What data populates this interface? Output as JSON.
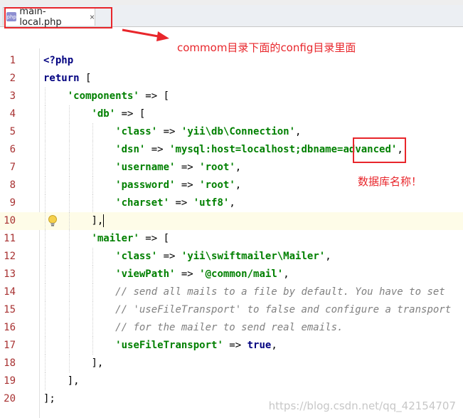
{
  "editor": {
    "tab": {
      "file_name": "main-local.php",
      "icon_label": "php",
      "close_glyph": "×"
    }
  },
  "annotations": {
    "config_note": "commom目录下面的config目录里面",
    "db_note": "数据库名称！"
  },
  "code": {
    "lines": [
      {
        "n": "1",
        "indent": 0,
        "parts": [
          {
            "t": "<?php",
            "c": "k"
          }
        ]
      },
      {
        "n": "2",
        "indent": 0,
        "parts": [
          {
            "t": "return",
            "c": "k"
          },
          {
            "t": " [",
            "c": ""
          }
        ]
      },
      {
        "n": "3",
        "indent": 1,
        "parts": [
          {
            "t": "'components'",
            "c": "s"
          },
          {
            "t": " => [",
            "c": ""
          }
        ]
      },
      {
        "n": "4",
        "indent": 2,
        "parts": [
          {
            "t": "'db'",
            "c": "s"
          },
          {
            "t": " => [",
            "c": ""
          }
        ]
      },
      {
        "n": "5",
        "indent": 3,
        "parts": [
          {
            "t": "'class'",
            "c": "s"
          },
          {
            "t": " => ",
            "c": ""
          },
          {
            "t": "'yii\\db\\Connection'",
            "c": "s"
          },
          {
            "t": ",",
            "c": ""
          }
        ]
      },
      {
        "n": "6",
        "indent": 3,
        "parts": [
          {
            "t": "'dsn'",
            "c": "s"
          },
          {
            "t": " => ",
            "c": ""
          },
          {
            "t": "'mysql:host=localhost;dbname=advanced'",
            "c": "s"
          },
          {
            "t": ",",
            "c": ""
          }
        ]
      },
      {
        "n": "7",
        "indent": 3,
        "parts": [
          {
            "t": "'username'",
            "c": "s"
          },
          {
            "t": " => ",
            "c": ""
          },
          {
            "t": "'root'",
            "c": "s"
          },
          {
            "t": ",",
            "c": ""
          }
        ]
      },
      {
        "n": "8",
        "indent": 3,
        "parts": [
          {
            "t": "'password'",
            "c": "s"
          },
          {
            "t": " => ",
            "c": ""
          },
          {
            "t": "'root'",
            "c": "s"
          },
          {
            "t": ",",
            "c": ""
          }
        ]
      },
      {
        "n": "9",
        "indent": 3,
        "parts": [
          {
            "t": "'charset'",
            "c": "s"
          },
          {
            "t": " => ",
            "c": ""
          },
          {
            "t": "'utf8'",
            "c": "s"
          },
          {
            "t": ",",
            "c": ""
          }
        ]
      },
      {
        "n": "10",
        "indent": 2,
        "parts": [
          {
            "t": "],",
            "c": ""
          }
        ],
        "current": true,
        "bulb": true,
        "caret": true
      },
      {
        "n": "11",
        "indent": 2,
        "parts": [
          {
            "t": "'mailer'",
            "c": "s"
          },
          {
            "t": " => [",
            "c": ""
          }
        ]
      },
      {
        "n": "12",
        "indent": 3,
        "parts": [
          {
            "t": "'class'",
            "c": "s"
          },
          {
            "t": " => ",
            "c": ""
          },
          {
            "t": "'yii\\swiftmailer\\Mailer'",
            "c": "s"
          },
          {
            "t": ",",
            "c": ""
          }
        ]
      },
      {
        "n": "13",
        "indent": 3,
        "parts": [
          {
            "t": "'viewPath'",
            "c": "s"
          },
          {
            "t": " => ",
            "c": ""
          },
          {
            "t": "'@common/mail'",
            "c": "s"
          },
          {
            "t": ",",
            "c": ""
          }
        ]
      },
      {
        "n": "14",
        "indent": 3,
        "parts": [
          {
            "t": "// send all mails to a file by default. You have to set",
            "c": "c"
          }
        ]
      },
      {
        "n": "15",
        "indent": 3,
        "parts": [
          {
            "t": "// 'useFileTransport' to false and configure a transport",
            "c": "c"
          }
        ]
      },
      {
        "n": "16",
        "indent": 3,
        "parts": [
          {
            "t": "// for the mailer to send real emails.",
            "c": "c"
          }
        ]
      },
      {
        "n": "17",
        "indent": 3,
        "parts": [
          {
            "t": "'useFileTransport'",
            "c": "s"
          },
          {
            "t": " => ",
            "c": ""
          },
          {
            "t": "true",
            "c": "k"
          },
          {
            "t": ",",
            "c": ""
          }
        ]
      },
      {
        "n": "18",
        "indent": 2,
        "parts": [
          {
            "t": "],",
            "c": ""
          }
        ]
      },
      {
        "n": "19",
        "indent": 1,
        "parts": [
          {
            "t": "],",
            "c": ""
          }
        ]
      },
      {
        "n": "20",
        "indent": 0,
        "parts": [
          {
            "t": "];",
            "c": ""
          }
        ]
      }
    ]
  },
  "watermark": "https://blog.csdn.net/qq_42154707",
  "colors": {
    "annotation_red": "#e8262b",
    "keyword": "#000080",
    "string": "#008000",
    "comment": "#808080",
    "line_number": "#a83232"
  }
}
